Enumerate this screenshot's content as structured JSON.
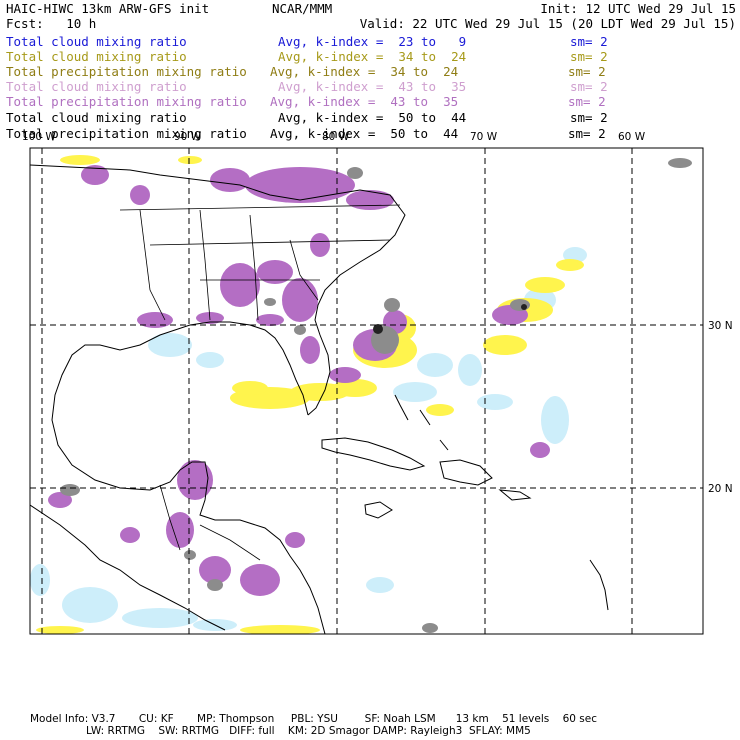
{
  "header": {
    "model_title": "HAIC-HIWC 13km ARW-GFS init",
    "org": "NCAR/MMM",
    "init": "Init: 12 UTC Wed 29 Jul 15",
    "forecast": "Fcst:   10 h",
    "valid": "Valid: 22 UTC Wed 29 Jul 15 (20 LDT Wed 29 Jul 15)"
  },
  "fields": [
    {
      "name": "Total cloud mixing ratio",
      "avg": "Avg, k-index =  23 to   9",
      "sm": "sm= 2",
      "color": "#1a1ad6"
    },
    {
      "name": "Total cloud mixing ratio",
      "avg": "Avg, k-index =  34 to  24",
      "sm": "sm= 2",
      "color": "#a79a1a"
    },
    {
      "name": "Total precipitation mixing ratio",
      "avg": "Avg, k-index =  34 to  24",
      "sm": "sm= 2",
      "color": "#8f7d14"
    },
    {
      "name": "Total cloud mixing ratio",
      "avg": "Avg, k-index =  43 to  35",
      "sm": "sm= 2",
      "color": "#cf9fcf"
    },
    {
      "name": "Total precipitation mixing ratio",
      "avg": "Avg, k-index =  43 to  35",
      "sm": "sm= 2",
      "color": "#b070c0"
    },
    {
      "name": "Total cloud mixing ratio",
      "avg": "Avg, k-index =  50 to  44",
      "sm": "sm= 2",
      "color": "#000000"
    },
    {
      "name": "Total precipitation mixing ratio",
      "avg": "Avg, k-index =  50 to  44",
      "sm": "sm= 2",
      "color": "#000000"
    }
  ],
  "axis_labels": {
    "lon_100w": "100 W",
    "lon_90w": "90 W",
    "lon_80w": "80 W",
    "lon_70w": "70 W",
    "lon_60w": "60 W",
    "lat_30n": "30 N",
    "lat_20n": "20 N"
  },
  "footer": {
    "line1": "Model Info: V3.7       CU: KF       MP: Thompson     PBL: YSU        SF: Noah LSM      13 km    51 levels    60 sec",
    "line2": "LW: RRTMG    SW: RRTMG   DIFF: full    KM: 2D Smagor DAMP: Rayleigh3  SFLAY: MM5"
  },
  "colors": {
    "low_cloud": "#cdeefa",
    "mid_cloud": "#fff44d",
    "high_cloud": "#b46ec4",
    "top_cloud": "#8c8c8c",
    "top_core": "#222222"
  }
}
